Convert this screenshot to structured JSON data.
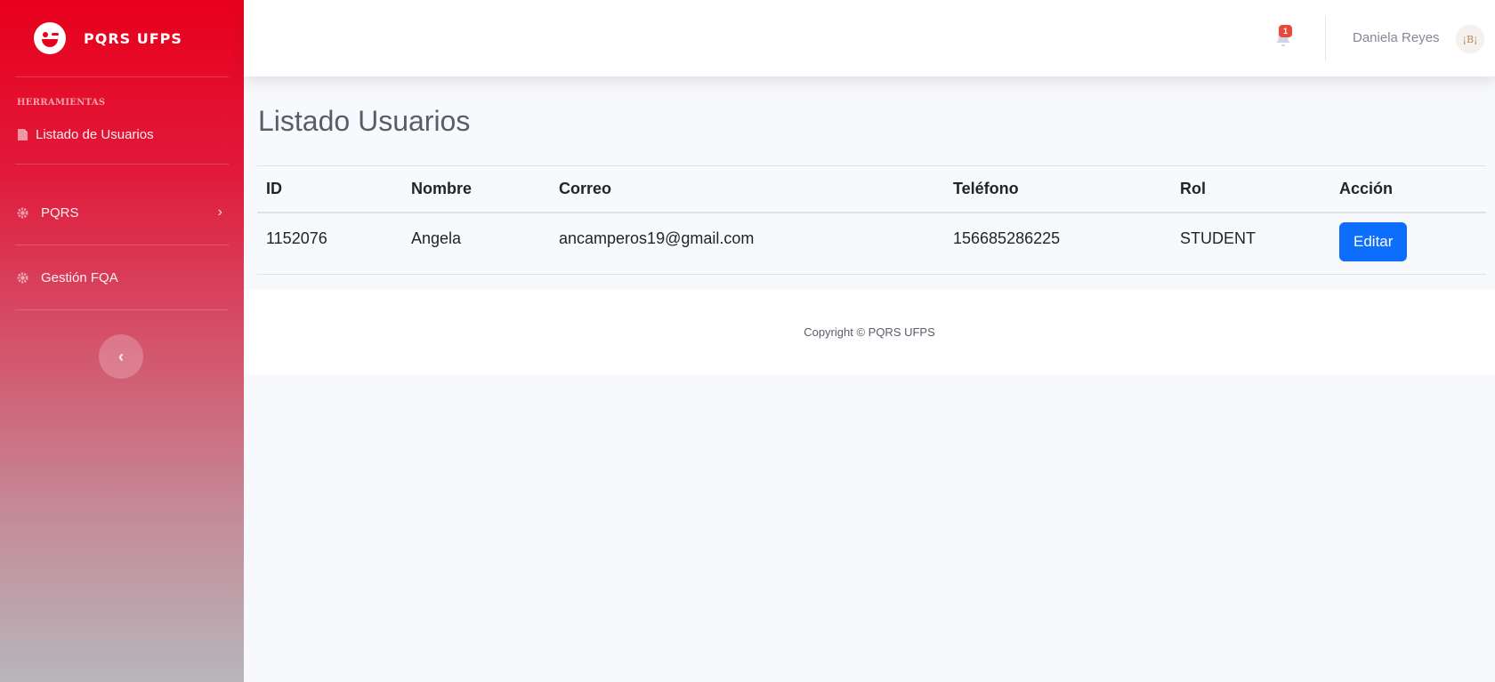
{
  "brand": {
    "name": "PQRS UFPS"
  },
  "sidebar": {
    "heading": "HERRAMIENTAS",
    "items": [
      {
        "label": "Listado de Usuarios",
        "icon": "file-icon"
      },
      {
        "label": "PQRS",
        "icon": "gear-icon"
      },
      {
        "label": "Gestión FQA",
        "icon": "gear-icon"
      }
    ]
  },
  "topbar": {
    "notifications_count": "1",
    "user_name": "Daniela Reyes",
    "avatar_text": "¡B¡"
  },
  "main": {
    "title": "Listado Usuarios",
    "table": {
      "headers": [
        "ID",
        "Nombre",
        "Correo",
        "Teléfono",
        "Rol",
        "Acción"
      ],
      "rows": [
        {
          "id": "1152076",
          "nombre": "Angela",
          "correo": "ancamperos19@gmail.com",
          "telefono": "156685286225",
          "rol": "STUDENT",
          "accion": "Editar"
        }
      ]
    }
  },
  "footer": {
    "text": "Copyright © PQRS UFPS"
  },
  "colors": {
    "accent": "#0d6efd",
    "brand_red": "#e8001c",
    "badge": "#e74a3b"
  }
}
